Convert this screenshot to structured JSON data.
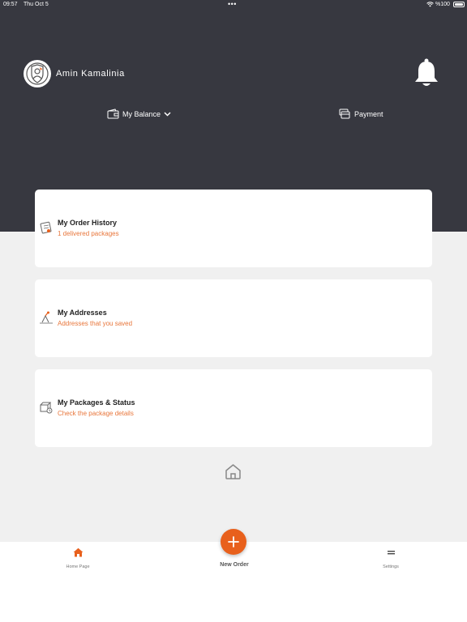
{
  "status_bar": {
    "time": "09:57",
    "date": "Thu Oct 5",
    "dots": "•••",
    "battery": "%100"
  },
  "header": {
    "user_name": "Amin Kamalinia",
    "balance_label": "My Balance",
    "payment_label": "Payment"
  },
  "cards": [
    {
      "title": "My Order History",
      "subtitle": "1 delivered packages",
      "icon": "order-history-icon"
    },
    {
      "title": "My Addresses",
      "subtitle": "Addresses that you saved",
      "icon": "addresses-icon"
    },
    {
      "title": "My Packages & Status",
      "subtitle": "Check the package details",
      "icon": "packages-icon"
    }
  ],
  "tabbar": {
    "home_label": "Home Page",
    "new_order_label": "New Order",
    "settings_label": "Settings"
  },
  "colors": {
    "header_bg": "#373840",
    "accent": "#e8601c",
    "subtitle": "#e8763b",
    "page_bg": "#f0f0f0"
  }
}
